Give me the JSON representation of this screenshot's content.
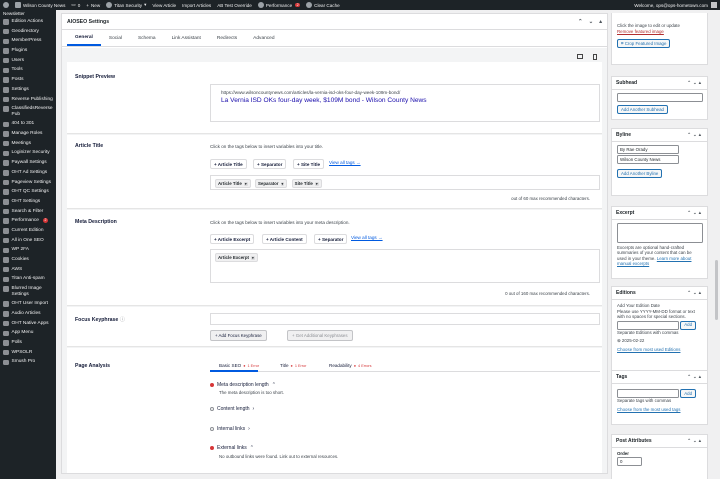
{
  "admin_bar": {
    "site_name": "Wilson County News",
    "comments_count": "0",
    "new_label": "New",
    "titan_label": "Titan Security",
    "view_article": "View Article",
    "import_articles": "Import Articles",
    "ab_test": "AB Test Override",
    "performance_label": "Performance",
    "performance_badge": "2",
    "clear_cache": "Clear Cache",
    "welcome": "Welcome, ops@ops-hometown.com"
  },
  "sidebar": {
    "top_label": "Newsletter",
    "items": [
      {
        "label": "Edition Actions"
      },
      {
        "label": "Geodirectory"
      },
      {
        "label": "MemberPress"
      },
      {
        "label": "Plugins"
      },
      {
        "label": "Users"
      },
      {
        "label": "Tools"
      },
      {
        "label": "Posts"
      },
      {
        "label": "Settings"
      },
      {
        "label": "Reverse Publishing"
      },
      {
        "label": "ClassifiedsReverse Pub"
      },
      {
        "label": "404 to 301"
      },
      {
        "label": "Manage Roles"
      },
      {
        "label": "Meetings"
      },
      {
        "label": "Loginizer Security"
      },
      {
        "label": "Paywall Settings"
      },
      {
        "label": "OHT Ad Settings"
      },
      {
        "label": "Pageview Settings"
      },
      {
        "label": "OHT QC Settings"
      },
      {
        "label": "OHT Settings"
      },
      {
        "label": "Search & Filter"
      },
      {
        "label": "Performance",
        "badge": "2"
      },
      {
        "label": "Current Edition"
      },
      {
        "label": "All in One SEO"
      },
      {
        "label": "WP 2FA"
      },
      {
        "label": "Cookies"
      },
      {
        "label": "AWS"
      },
      {
        "label": "Titan Anti-spam"
      },
      {
        "label": "Blurred Image Settings"
      },
      {
        "label": "OHT User Import"
      },
      {
        "label": "Audio Articles"
      },
      {
        "label": "OHT Native Apps"
      },
      {
        "label": "App Menu"
      },
      {
        "label": "Polls"
      },
      {
        "label": "WPSOLR"
      },
      {
        "label": "Smush Pro"
      }
    ]
  },
  "aioseo": {
    "title": "AIOSEO Settings",
    "tabs": [
      "General",
      "Social",
      "Schema",
      "Link Assistant",
      "Redirects",
      "Advanced"
    ],
    "snippet_preview": {
      "label": "Snippet Preview",
      "url": "https://www.wilsoncountynews.com/articles/la-vernia-isd-oks-four-day-week-109m-bond/",
      "title": "La Vernia ISD OKs four-day week, $109M bond - Wilson County News"
    },
    "article_title": {
      "label": "Article Title",
      "hint": "Click on the tags below to insert variables into your title.",
      "tag_buttons": [
        "+ Article Title",
        "+ Separator",
        "+ Site Title"
      ],
      "view_all": "View all tags →",
      "chips": [
        "Article Title",
        "Separator",
        "Site Title"
      ],
      "counter": "out of 60 max recommended characters."
    },
    "meta_description": {
      "label": "Meta Description",
      "hint": "Click on the tags below to insert variables into your meta description.",
      "tag_buttons": [
        "+ Article Excerpt",
        "+ Article Content",
        "+ Separator"
      ],
      "view_all": "View all tags →",
      "chips": [
        "Article Excerpt"
      ],
      "counter": "0 out of 160 max recommended characters."
    },
    "focus_keyphrase": {
      "label": "Focus Keyphrase",
      "value": "",
      "add_button": "Add Focus Keyphrase",
      "additional_button": "Get Additional Keyphrases"
    },
    "page_analysis": {
      "label": "Page Analysis",
      "tabs": [
        {
          "label": "Basic SEO",
          "errors": "1 Error"
        },
        {
          "label": "Title",
          "errors": "1 Error"
        },
        {
          "label": "Readability",
          "errors": "4 Errors"
        }
      ],
      "checks": [
        {
          "label": "Meta description length",
          "detail": "The meta description is too short.",
          "status": "error"
        },
        {
          "label": "Content length",
          "detail": "",
          "status": "neutral"
        },
        {
          "label": "Internal links",
          "detail": "",
          "status": "neutral"
        },
        {
          "label": "External links",
          "detail": "No outbound links were found. Link out to external resources.",
          "status": "error"
        }
      ]
    }
  },
  "right_sidebar": {
    "featured_image": {
      "hint": "Click the image to edit or update",
      "remove": "Remove featured image",
      "crop": "Crop Featured Image"
    },
    "subhead": {
      "title": "Subhead",
      "add": "Add Another Subhead"
    },
    "byline": {
      "title": "Byline",
      "name": "By Rae Orady",
      "org": "Wilson County News",
      "add": "Add Another Byline"
    },
    "excerpt": {
      "title": "Excerpt",
      "desc": "Excerpts are optional hand-crafted summaries of your content that can be used in your theme.",
      "learn": "Learn more about manual excerpts"
    },
    "editions": {
      "title": "Editions",
      "label": "Add Your Edition Date",
      "desc": "Please use YYYY-MM-DD format or text with no spaces for special sections.",
      "add": "Add",
      "sep_note": "Separate Editions with commas",
      "tag": "2025-02-22",
      "most_used": "Choose from most used Editions"
    },
    "tags": {
      "title": "Tags",
      "add": "Add",
      "sep_note": "Separate tags with commas",
      "most_used": "Choose from the most used tags"
    },
    "post_attributes": {
      "title": "Post Attributes",
      "order_label": "Order",
      "order_value": "0"
    }
  }
}
